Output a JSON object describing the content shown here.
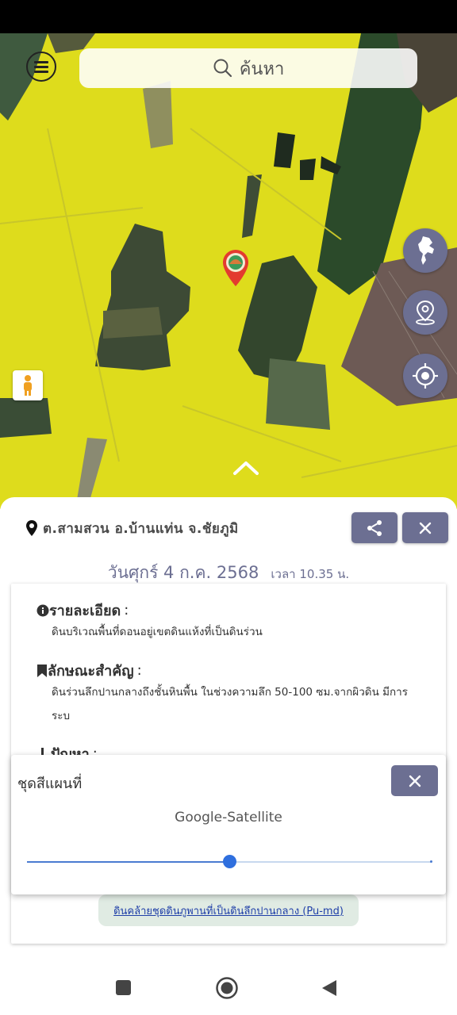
{
  "search": {
    "placeholder": "ค้นหา"
  },
  "location": {
    "text": "ต.สามสวน  อ.บ้านแท่น  จ.ชัยภูมิ"
  },
  "date": {
    "main": "วันศุกร์  4 ก.ค. 2568",
    "time": "เวลา 10.35 น."
  },
  "sections": [
    {
      "title": "รายละเอียด",
      "suffix": ":",
      "body": "ดินบริเวณพื้นที่ดอนอยู่เขตดินแห้งที่เป็นดินร่วน"
    },
    {
      "title": "ลักษณะสำคัญ",
      "suffix": ":",
      "body": "ดินร่วนลึกปานกลางถึงชั้นหินพื้น ในช่วงความลึก 50-100 ซม.จากผิวดิน มีการระบ"
    },
    {
      "title": "ปัญหา",
      "suffix": ":"
    }
  ],
  "link": {
    "text": "ดินคล้ายชุดดินภูพานที่เป็นดินลึกปานกลาง (Pu-md)"
  },
  "dialog": {
    "title": "ชุดสีแผนที่",
    "value": "Google-Satellite",
    "slider_fraction": 0.5
  },
  "icons": {
    "menu": "menu-icon",
    "search": "search-icon",
    "thailand_map": "thailand-map-icon",
    "place": "place-marker-icon",
    "my_location": "crosshair-icon",
    "street_view": "pegman-icon",
    "expand": "chevron-up-icon",
    "location": "location-pin-icon",
    "share": "share-icon",
    "close": "close-icon",
    "info": "info-icon",
    "bookmark": "bookmark-icon",
    "alert": "alert-icon"
  },
  "colors": {
    "accent": "#6c6f92",
    "map_overlay": "#dedc1c",
    "slider": "#2f6fde",
    "link": "#1f3fa8"
  }
}
